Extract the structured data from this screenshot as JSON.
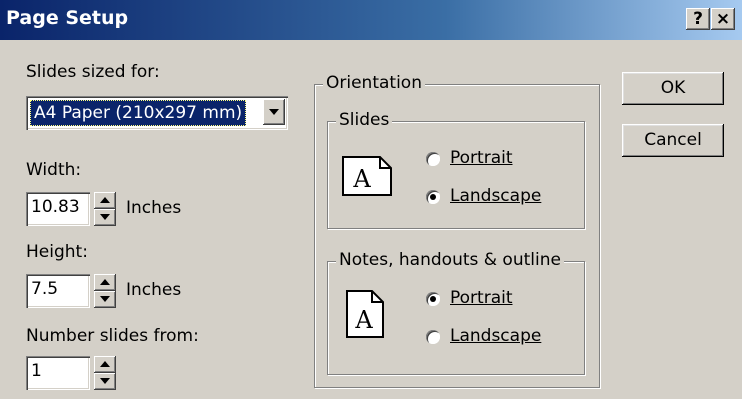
{
  "window": {
    "title": "Page Setup",
    "help_label": "?",
    "close_label": "×"
  },
  "slides_sized_for": {
    "label": "Slides sized for:",
    "selected": "A4 Paper (210x297 mm)"
  },
  "width": {
    "label": "Width:",
    "value": "10.83",
    "unit": "Inches"
  },
  "height": {
    "label": "Height:",
    "value": "7.5",
    "unit": "Inches"
  },
  "number_from": {
    "label": "Number slides from:",
    "value": "1"
  },
  "orientation": {
    "title": "Orientation",
    "slides": {
      "title": "Slides",
      "portrait": "Portrait",
      "landscape": "Landscape",
      "selected": "Landscape"
    },
    "notes": {
      "title": "Notes, handouts & outline",
      "portrait": "Portrait",
      "landscape": "Landscape",
      "selected": "Portrait"
    }
  },
  "buttons": {
    "ok": "OK",
    "cancel": "Cancel"
  },
  "icons": {
    "page_letter": "A"
  }
}
